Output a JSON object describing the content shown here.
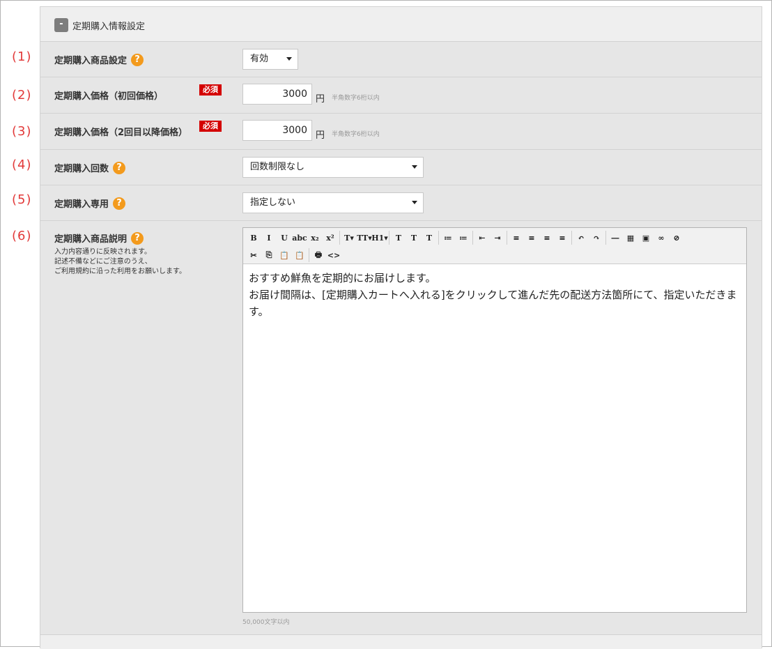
{
  "panel": {
    "collapse_symbol": "-",
    "title": "定期購入情報設定"
  },
  "rows": [
    {
      "num": "(1)",
      "label": "定期購入商品設定",
      "has_help": true,
      "control": "select",
      "select_value": "有効"
    },
    {
      "num": "(2)",
      "label": "定期購入価格（初回価格）",
      "required": "必須",
      "control": "text",
      "input_value": "3000",
      "unit": "円",
      "hint": "半角数字6桁以内"
    },
    {
      "num": "(3)",
      "label": "定期購入価格（2回目以降価格）",
      "required": "必須",
      "control": "text",
      "input_value": "3000",
      "unit": "円",
      "hint": "半角数字6桁以内"
    },
    {
      "num": "(4)",
      "label": "定期購入回数",
      "has_help": true,
      "control": "select",
      "select_value": "回数制限なし"
    },
    {
      "num": "(5)",
      "label": "定期購入専用",
      "has_help": true,
      "control": "select",
      "select_value": "指定しない"
    },
    {
      "num": "(6)",
      "label": "定期購入商品説明",
      "has_help": true,
      "control": "editor",
      "description": [
        "入力内容通りに反映されます。",
        "記述不備などにご注意のうえ、",
        "ご利用規約に沿った利用をお願いします。"
      ]
    }
  ],
  "help_symbol": "?",
  "editor": {
    "toolbar_row1": [
      "B",
      "I",
      "U",
      "abc",
      "x₂",
      "x²",
      "T▾",
      "TT▾",
      "H1▾",
      "T",
      "T",
      "T",
      "≔",
      "≔",
      "⇤",
      "⇥",
      "≡",
      "≡",
      "≡",
      "≡",
      "↶",
      "↷",
      "―",
      "▦",
      "▣",
      "∞",
      "⊘"
    ],
    "toolbar_row2": [
      "✂",
      "⎘",
      "📋",
      "📋",
      "🖶",
      "<>"
    ],
    "content_lines": [
      "おすすめ鮮魚を定期的にお届けします。",
      "お届け間隔は、[定期購入カートへ入れる]をクリックして進んだ先の配送方法箇所にて、指定いただきます。"
    ],
    "char_limit": "50,000文字以内"
  },
  "colors": {
    "accent_help": "#f39a1c",
    "required_badge": "#d40000",
    "number_label": "#e23a3a"
  }
}
